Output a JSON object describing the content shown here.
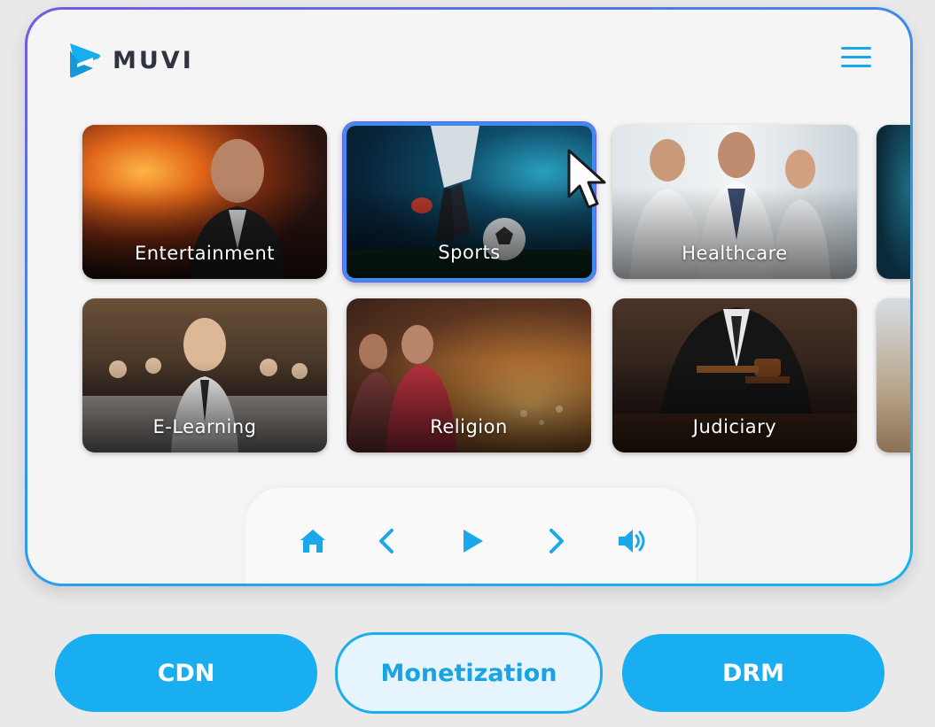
{
  "brand": {
    "name": "MUVI",
    "accent": "#19aef0",
    "text_color": "#2f3440"
  },
  "header": {
    "menu_icon": "hamburger-menu-icon"
  },
  "categories": [
    {
      "label": "Entertainment",
      "selected": false
    },
    {
      "label": "Sports",
      "selected": true
    },
    {
      "label": "Healthcare",
      "selected": false
    },
    {
      "label": "E-Learning",
      "selected": false
    },
    {
      "label": "Religion",
      "selected": false
    },
    {
      "label": "Judiciary",
      "selected": false
    }
  ],
  "controls": [
    "home-icon",
    "chevron-left-icon",
    "play-icon",
    "chevron-right-icon",
    "volume-icon"
  ],
  "buttons": [
    {
      "label": "CDN",
      "style": "solid"
    },
    {
      "label": "Monetization",
      "style": "outline"
    },
    {
      "label": "DRM",
      "style": "solid"
    }
  ]
}
